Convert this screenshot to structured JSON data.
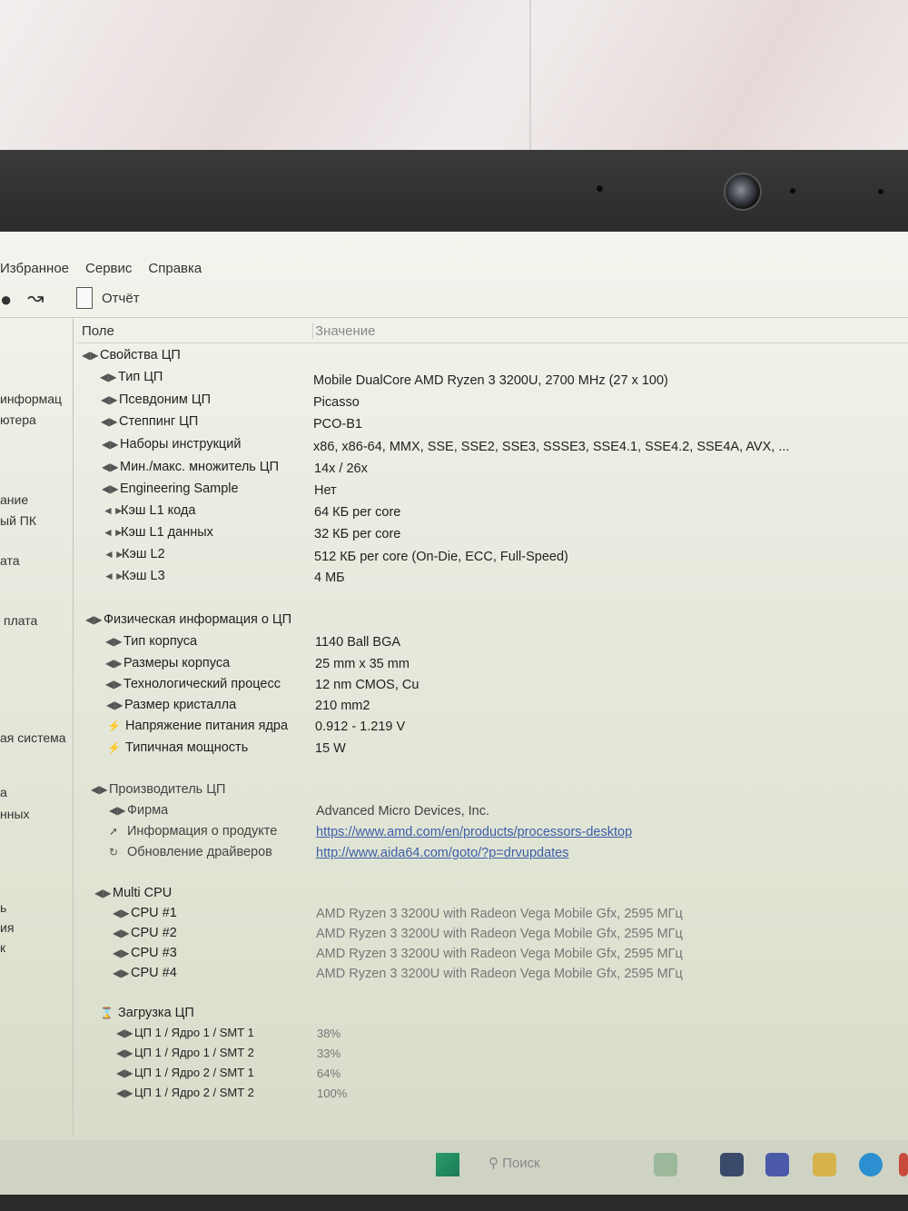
{
  "menu": [
    "Избранное",
    "Сервис",
    "Справка"
  ],
  "toolbar": {
    "report_label": "Отчёт"
  },
  "sidebar": [
    "информац",
    "ютера",
    "ание",
    "ый ПК",
    "ата",
    "плата",
    "ая система",
    "а",
    "нных",
    "ь",
    "ия",
    "к"
  ],
  "columns": {
    "field": "Поле",
    "value": "Значение"
  },
  "sections": {
    "cpu_props": {
      "title": "Свойства ЦП",
      "rows": [
        {
          "label": "Тип ЦП",
          "value": "Mobile DualCore AMD Ryzen 3 3200U, 2700 MHz (27 x 100)"
        },
        {
          "label": "Псевдоним ЦП",
          "value": "Picasso"
        },
        {
          "label": "Степпинг ЦП",
          "value": "PCO-B1"
        },
        {
          "label": "Наборы инструкций",
          "value": "x86, x86-64, MMX, SSE, SSE2, SSE3, SSSE3, SSE4.1, SSE4.2, SSE4A, AVX, ..."
        },
        {
          "label": "Мин./макс. множитель ЦП",
          "value": "14x / 26x"
        },
        {
          "label": "Engineering Sample",
          "value": "Нет"
        },
        {
          "label": "Кэш L1 кода",
          "value": "64 КБ per core"
        },
        {
          "label": "Кэш L1 данных",
          "value": "32 КБ per core"
        },
        {
          "label": "Кэш L2",
          "value": "512 КБ per core  (On-Die, ECC, Full-Speed)"
        },
        {
          "label": "Кэш L3",
          "value": "4 МБ"
        }
      ]
    },
    "physical": {
      "title": "Физическая информация о ЦП",
      "rows": [
        {
          "label": "Тип корпуса",
          "value": "1140 Ball BGA"
        },
        {
          "label": "Размеры корпуса",
          "value": "25 mm x 35 mm"
        },
        {
          "label": "Технологический процесс",
          "value": "12 nm CMOS, Cu"
        },
        {
          "label": "Размер кристалла",
          "value": "210 mm2"
        },
        {
          "label": "Напряжение питания ядра",
          "value": "0.912 - 1.219 V"
        },
        {
          "label": "Типичная мощность",
          "value": "15 W"
        }
      ]
    },
    "manufacturer": {
      "title": "Производитель ЦП",
      "rows": [
        {
          "label": "Фирма",
          "value": "Advanced Micro Devices, Inc."
        },
        {
          "label": "Информация о продукте",
          "value": "https://www.amd.com/en/products/processors-desktop"
        },
        {
          "label": "Обновление драйверов",
          "value": "http://www.aida64.com/goto/?p=drvupdates"
        }
      ]
    },
    "multi_cpu": {
      "title": "Multi CPU",
      "rows": [
        {
          "label": "CPU #1",
          "value": "AMD Ryzen 3 3200U with Radeon Vega Mobile Gfx, 2595 МГц"
        },
        {
          "label": "CPU #2",
          "value": "AMD Ryzen 3 3200U with Radeon Vega Mobile Gfx, 2595 МГц"
        },
        {
          "label": "CPU #3",
          "value": "AMD Ryzen 3 3200U with Radeon Vega Mobile Gfx, 2595 МГц"
        },
        {
          "label": "CPU #4",
          "value": "AMD Ryzen 3 3200U with Radeon Vega Mobile Gfx, 2595 МГц"
        }
      ]
    },
    "load": {
      "title": "Загрузка ЦП",
      "rows": [
        {
          "label": "ЦП 1 / Ядро 1 / SMT 1",
          "value": "38%"
        },
        {
          "label": "ЦП 1 / Ядро 1 / SMT 2",
          "value": "33%"
        },
        {
          "label": "ЦП 1 / Ядро 2 / SMT 1",
          "value": "64%"
        },
        {
          "label": "ЦП 1 / Ядро 2 / SMT 2",
          "value": "100%"
        }
      ]
    }
  },
  "taskbar": {
    "search_placeholder": "Поиск"
  }
}
